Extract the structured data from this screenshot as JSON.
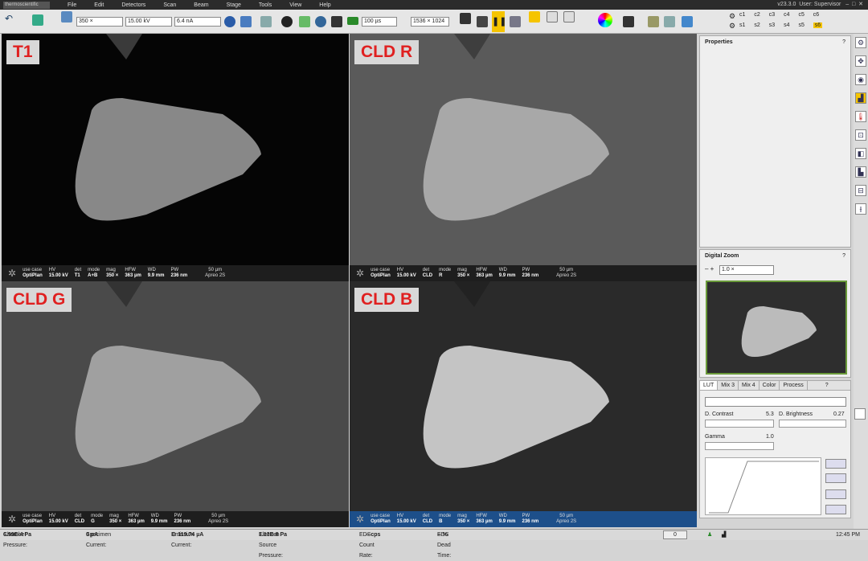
{
  "menu": {
    "brand": "thermoscientific",
    "items": [
      "File",
      "Edit",
      "Detectors",
      "Scan",
      "Beam",
      "Stage",
      "Tools",
      "View",
      "Help"
    ],
    "version": "v23.3.0",
    "user": "User: Supervisor"
  },
  "toolbar": {
    "mag": "350 ×",
    "hv": "15.00 kV",
    "current": "6.4 nA",
    "dwell": "100 µs",
    "resolution": "1536 × 1024",
    "c_row1": [
      "c1",
      "c2",
      "c3",
      "c4",
      "c5",
      "c6"
    ],
    "s_row2": [
      "s1",
      "s2",
      "s3",
      "s4",
      "s5",
      "s6"
    ]
  },
  "quads": [
    {
      "label": "T1",
      "usecase": "OptiPlan",
      "hv": "15.00 kV",
      "det": "T1",
      "mode": "A+B",
      "mag": "350 ×",
      "hfw": "363 µm",
      "wd": "9.9 mm",
      "pw": "236 nm",
      "scale": "50 µm",
      "instrument": "Apreo 2S"
    },
    {
      "label": "CLD R",
      "usecase": "OptiPlan",
      "hv": "15.00 kV",
      "det": "CLD",
      "mode": "R",
      "mag": "350 ×",
      "hfw": "363 µm",
      "wd": "9.9 mm",
      "pw": "236 nm",
      "scale": "50 µm",
      "instrument": "Apreo 2S"
    },
    {
      "label": "CLD G",
      "usecase": "OptiPlan",
      "hv": "15.00 kV",
      "det": "CLD",
      "mode": "G",
      "mag": "350 ×",
      "hfw": "363 µm",
      "wd": "9.9 mm",
      "pw": "236 nm",
      "scale": "50 µm",
      "instrument": "Apreo 2S"
    },
    {
      "label": "CLD B",
      "usecase": "OptiPlan",
      "hv": "15.00 kV",
      "det": "CLD",
      "mode": "B",
      "mag": "350 ×",
      "hfw": "363 µm",
      "wd": "9.9 mm",
      "pw": "236 nm",
      "scale": "50 µm",
      "instrument": "Apreo 2S"
    }
  ],
  "infolabels": {
    "usecase": "use case",
    "hv": "HV",
    "det": "det",
    "mode": "mode",
    "mag": "mag",
    "hfw": "HFW",
    "wd": "WD",
    "pw": "PW"
  },
  "properties": {
    "title": "Properties",
    "help": "?"
  },
  "zoom": {
    "title": "Digital Zoom",
    "value": "1.0 ×",
    "help": "?"
  },
  "lut": {
    "tabs": [
      "LUT",
      "Mix 3",
      "Mix 4",
      "Color",
      "Process"
    ],
    "help": "?",
    "contrast_label": "D. Contrast",
    "contrast": "5.3",
    "brightness_label": "D. Brightness",
    "brightness": "0.27",
    "gamma_label": "Gamma",
    "gamma": "1.0"
  },
  "status": {
    "chamber_label": "Chamber Pressure:",
    "chamber": "6.99E-4 Pa",
    "specimen_label": "Specimen Current:",
    "specimen": "0 pA",
    "emission_label": "Emission Current:",
    "emission": "119.74 µA",
    "source_label": "Electron Source Pressure:",
    "source": "1.13E-8 Pa",
    "eds_label": "EDS Count Rate:",
    "eds": "-- cps",
    "dead_label": "EDS Dead Time:",
    "dead": "-- %",
    "zero": "0",
    "time": "12:45 PM"
  }
}
